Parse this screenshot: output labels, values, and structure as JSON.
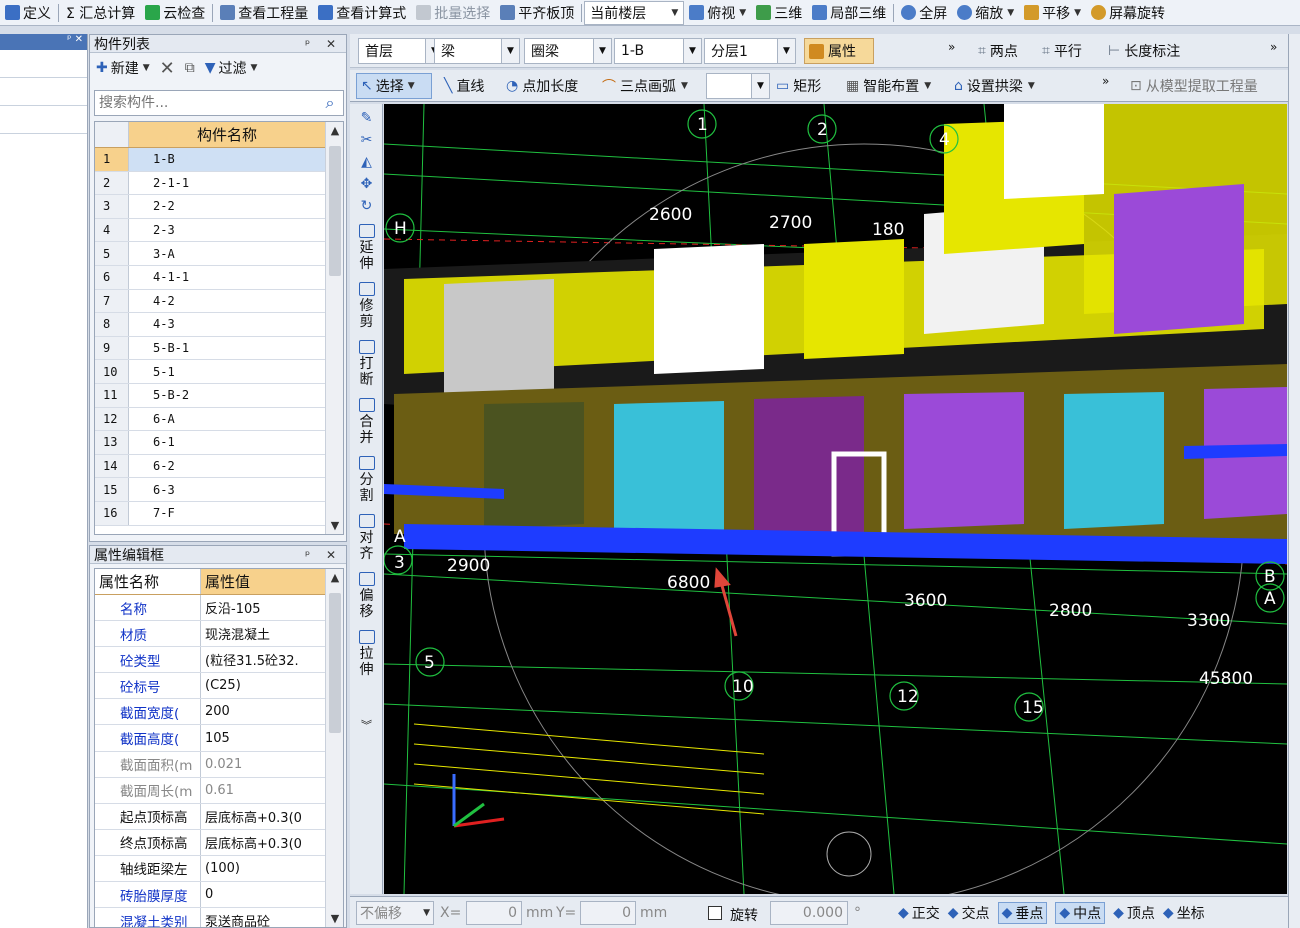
{
  "toolbar": {
    "items": [
      {
        "label": "定义",
        "color": "#3b6fc4"
      },
      {
        "label": "Σ 汇总计算",
        "color": "#ffffff"
      },
      {
        "label": "云检查",
        "color": "#2aa64a"
      },
      {
        "label": "查看工程量",
        "color": "#5a7fb8"
      },
      {
        "label": "查看计算式",
        "color": "#3b6fc4"
      },
      {
        "label": "批量选择",
        "color": "#9aa4b0"
      },
      {
        "label": "平齐板顶",
        "color": "#5a7fb8"
      }
    ],
    "floor_label": "当前楼层",
    "right_items": [
      {
        "label": "俯视",
        "color": "#4b7cc8"
      },
      {
        "label": "三维",
        "color": "#3e9c4a"
      },
      {
        "label": "局部三维",
        "color": "#4b7cc8"
      },
      {
        "label": "全屏",
        "color": "#4b7cc8"
      },
      {
        "label": "缩放",
        "color": "#4b7cc8"
      },
      {
        "label": "平移",
        "color": "#d39a2a"
      },
      {
        "label": "屏幕旋转",
        "color": "#d39a2a"
      }
    ]
  },
  "component_list": {
    "title": "构件列表",
    "new_label": "新建",
    "filter_label": "过滤",
    "search_placeholder": "搜索构件...",
    "column_header": "构件名称",
    "rows": [
      {
        "n": "1",
        "name": "1-B"
      },
      {
        "n": "2",
        "name": "2-1-1"
      },
      {
        "n": "3",
        "name": "2-2"
      },
      {
        "n": "4",
        "name": "2-3"
      },
      {
        "n": "5",
        "name": "3-A"
      },
      {
        "n": "6",
        "name": "4-1-1"
      },
      {
        "n": "7",
        "name": "4-2"
      },
      {
        "n": "8",
        "name": "4-3"
      },
      {
        "n": "9",
        "name": "5-B-1"
      },
      {
        "n": "10",
        "name": "5-1"
      },
      {
        "n": "11",
        "name": "5-B-2"
      },
      {
        "n": "12",
        "name": "6-A"
      },
      {
        "n": "13",
        "name": "6-1"
      },
      {
        "n": "14",
        "name": "6-2"
      },
      {
        "n": "15",
        "name": "6-3"
      },
      {
        "n": "16",
        "name": "7-F"
      }
    ]
  },
  "property_box": {
    "title": "属性编辑框",
    "col_name": "属性名称",
    "col_value": "属性值",
    "rows": [
      {
        "k": "名称",
        "v": "反沿-105",
        "style": "blue"
      },
      {
        "k": "材质",
        "v": "现浇混凝土",
        "style": "blue"
      },
      {
        "k": "砼类型",
        "v": "(粒径31.5砼32.",
        "style": "blue"
      },
      {
        "k": "砼标号",
        "v": "(C25)",
        "style": "blue"
      },
      {
        "k": "截面宽度(",
        "v": "200",
        "style": "blue"
      },
      {
        "k": "截面高度(",
        "v": "105",
        "style": "blue"
      },
      {
        "k": "截面面积(m",
        "v": "0.021",
        "style": "gray"
      },
      {
        "k": "截面周长(m",
        "v": "0.61",
        "style": "gray"
      },
      {
        "k": "起点顶标高",
        "v": "层底标高+0.3(0",
        "style": "black"
      },
      {
        "k": "终点顶标高",
        "v": "层底标高+0.3(0",
        "style": "black"
      },
      {
        "k": "轴线距梁左",
        "v": "(100)",
        "style": "black"
      },
      {
        "k": "砖胎膜厚度",
        "v": "0",
        "style": "blue"
      },
      {
        "k": "混凝土类别",
        "v": "泵送商品砼",
        "style": "blue"
      }
    ]
  },
  "selectors": {
    "floor": "首层",
    "type": "梁",
    "subtype": "圈梁",
    "component": "1-B",
    "layer": "分层1",
    "property_btn": "属性",
    "two_point": "两点",
    "parallel": "平行",
    "length_mark": "长度标注"
  },
  "draw_toolbar": {
    "select": "选择",
    "line": "直线",
    "point_length": "点加长度",
    "arc": "三点画弧",
    "rect": "矩形",
    "smart_layout": "智能布置",
    "set_arch": "设置拱梁",
    "extract": "从模型提取工程量"
  },
  "side_tools": [
    {
      "label": "延伸"
    },
    {
      "label": "修剪"
    },
    {
      "label": "打断"
    },
    {
      "label": "合并"
    },
    {
      "label": "分割"
    },
    {
      "label": "对齐"
    },
    {
      "label": "偏移"
    },
    {
      "label": "拉伸"
    }
  ],
  "viewport": {
    "dimensions": [
      {
        "text": "2600"
      },
      {
        "text": "2700"
      },
      {
        "text": "180"
      },
      {
        "text": "2900"
      },
      {
        "text": "6800"
      },
      {
        "text": "3600"
      },
      {
        "text": "2800"
      },
      {
        "text": "3300"
      },
      {
        "text": "45800"
      }
    ],
    "axis_labels": [
      "1",
      "2",
      "4",
      "5",
      "10",
      "12",
      "15",
      "B",
      "A",
      "3",
      "A",
      "H"
    ],
    "colors": {
      "bg": "#000000",
      "wall": "#6b5d13",
      "beam": "#e6e600",
      "slab": "#1e3cff",
      "grid": "#20c040",
      "arrow": "#e0463a"
    }
  },
  "status_bar": {
    "no_offset": "不偏移",
    "x_label": "X=",
    "x_value": "0",
    "y_label": "Y=",
    "y_value": "0",
    "unit": "mm",
    "rotate_label": "旋转",
    "rotate_value": "0.000",
    "degree": "°",
    "snaps": [
      "正交",
      "交点",
      "垂点",
      "中点",
      "顶点",
      "坐标"
    ]
  }
}
